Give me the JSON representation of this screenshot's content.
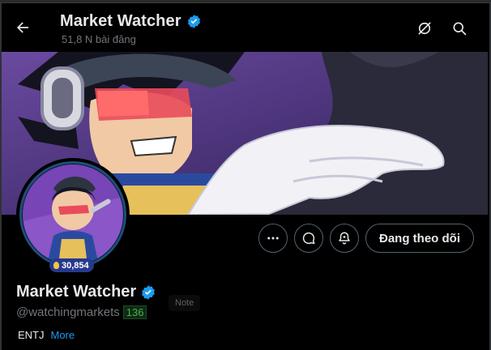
{
  "header": {
    "title": "Market Watcher",
    "post_count": "51,8 N bài đăng"
  },
  "profile": {
    "display_name": "Market Watcher",
    "handle": "@watchingmarkets",
    "handle_count": "136",
    "score": "30,854",
    "note": "Note",
    "bio": "ENTJ",
    "bio_more": "More"
  },
  "actions": {
    "follow_label": "Đang theo dõi"
  },
  "colors": {
    "verified": "#1d9bf0",
    "banner_bg": "#4a2b7c",
    "link": "#1d9bf0"
  },
  "icons": [
    "back-arrow-icon",
    "grok-icon",
    "search-icon",
    "more-horizontal-icon",
    "message-icon",
    "notification-bell-icon",
    "verified-badge-icon",
    "lightbulb-icon"
  ]
}
